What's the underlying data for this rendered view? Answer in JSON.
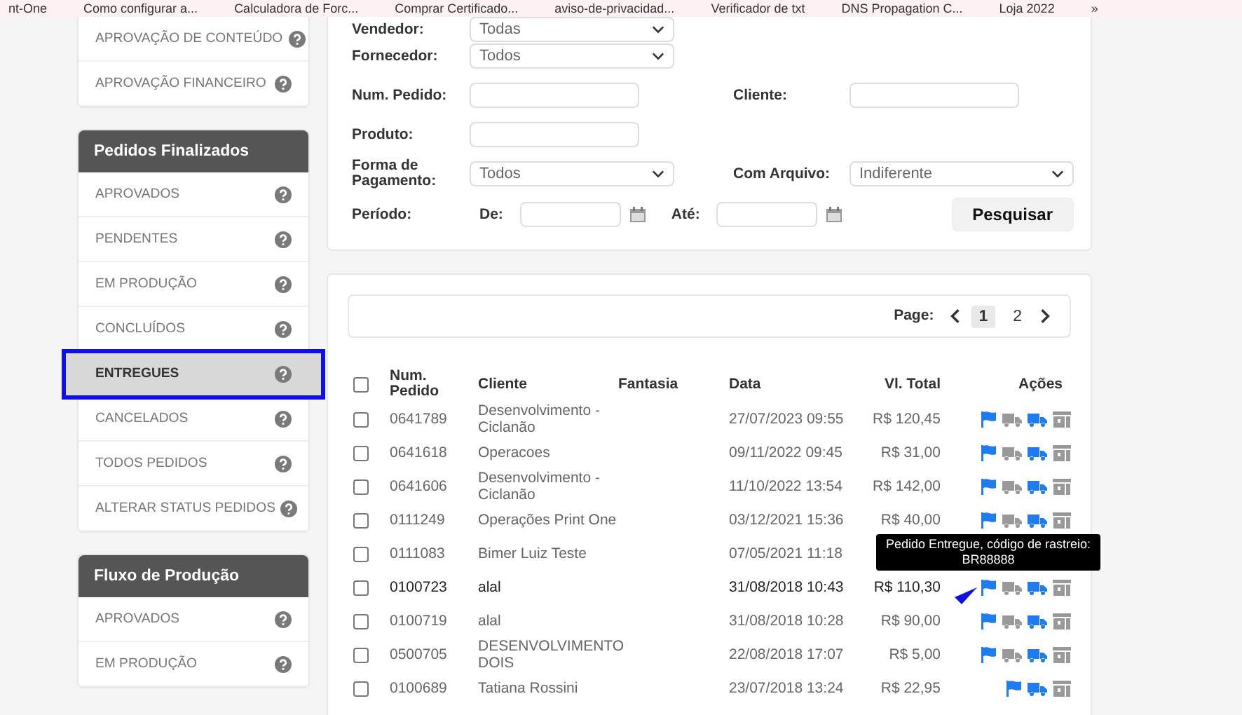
{
  "bookmarks": [
    "nt-One",
    "Como configurar a...",
    "Calculadora de Forc...",
    "Comprar Certificado...",
    "aviso-de-privacidad...",
    "Verificador de txt",
    "DNS Propagation C...",
    "Loja 2022",
    "»"
  ],
  "sidebar": {
    "sections": [
      {
        "items": [
          {
            "label": "APROVAÇÃO DE CONTEÚDO",
            "selected": false
          },
          {
            "label": "APROVAÇÃO FINANCEIRO",
            "selected": false
          }
        ]
      },
      {
        "title": "Pedidos Finalizados",
        "items": [
          {
            "label": "APROVADOS",
            "selected": false
          },
          {
            "label": "PENDENTES",
            "selected": false
          },
          {
            "label": "EM PRODUÇÃO",
            "selected": false
          },
          {
            "label": "CONCLUÍDOS",
            "selected": false
          },
          {
            "label": "ENTREGUES",
            "selected": true
          },
          {
            "label": "CANCELADOS",
            "selected": false
          },
          {
            "label": "TODOS PEDIDOS",
            "selected": false
          },
          {
            "label": "ALTERAR STATUS PEDIDOS",
            "selected": false
          }
        ]
      },
      {
        "title": "Fluxo de Produção",
        "items": [
          {
            "label": "APROVADOS",
            "selected": false
          },
          {
            "label": "EM PRODUÇÃO",
            "selected": false
          }
        ]
      }
    ]
  },
  "filters": {
    "rows": [
      {
        "fields": [
          {
            "label": "Vendedor:",
            "kind": "select",
            "value": "Todas"
          }
        ]
      },
      {
        "fields": [
          {
            "label": "Fornecedor:",
            "kind": "select",
            "value": "Todos"
          }
        ]
      },
      {
        "fields": [
          {
            "label": "Num. Pedido:",
            "kind": "text"
          },
          {
            "label": "Cliente:",
            "kind": "text"
          }
        ]
      },
      {
        "fields": [
          {
            "label": "Produto:",
            "kind": "text"
          }
        ]
      },
      {
        "fields": [
          {
            "label": "Forma de Pagamento:",
            "kind": "select",
            "value": "Todos"
          },
          {
            "label": "Com Arquivo:",
            "kind": "select",
            "value": "Indiferente"
          }
        ]
      }
    ],
    "period": {
      "label": "Período:",
      "from_label": "De:",
      "to_label": "Até:"
    },
    "search_button": "Pesquisar"
  },
  "pager": {
    "label": "Page:",
    "pages": [
      {
        "label": "1",
        "selected": true
      },
      {
        "label": "2",
        "selected": false
      }
    ]
  },
  "table": {
    "columns": [
      "Num. Pedido",
      "Cliente",
      "Fantasia",
      "Data",
      "Vl. Total",
      "Ações"
    ],
    "header_checked": false,
    "rows": [
      {
        "num": "0641789",
        "cliente": "Desenvolvimento - Ciclanão",
        "data": "27/07/2023 09:55",
        "total": "R$ 120,45",
        "checked": false,
        "highlighted": false,
        "actions": [
          {
            "kind": "flag"
          },
          {
            "kind": "truck",
            "active": false
          },
          {
            "kind": "truck",
            "active": true
          },
          {
            "kind": "archive"
          }
        ]
      },
      {
        "num": "0641618",
        "cliente": "Operacoes",
        "data": "09/11/2022 09:45",
        "total": "R$ 31,00",
        "checked": false,
        "highlighted": false,
        "actions": [
          {
            "kind": "flag"
          },
          {
            "kind": "truck",
            "active": false
          },
          {
            "kind": "truck",
            "active": true
          },
          {
            "kind": "archive"
          }
        ]
      },
      {
        "num": "0641606",
        "cliente": "Desenvolvimento - Ciclanão",
        "data": "11/10/2022 13:54",
        "total": "R$ 142,00",
        "checked": false,
        "highlighted": false,
        "actions": [
          {
            "kind": "flag"
          },
          {
            "kind": "truck",
            "active": false
          },
          {
            "kind": "truck",
            "active": true
          },
          {
            "kind": "archive"
          }
        ]
      },
      {
        "num": "0111249",
        "cliente": "Operações Print One",
        "data": "03/12/2021 15:36",
        "total": "R$ 40,00",
        "checked": false,
        "highlighted": false,
        "actions": [
          {
            "kind": "flag"
          },
          {
            "kind": "truck",
            "active": false
          },
          {
            "kind": "truck",
            "active": true
          },
          {
            "kind": "archive"
          }
        ]
      },
      {
        "num": "0111083",
        "cliente": "Bimer Luiz Teste",
        "data": "07/05/2021 11:18",
        "checked": false,
        "highlighted": false
      },
      {
        "num": "0100723",
        "cliente": "alal",
        "data": "31/08/2018 10:43",
        "total": "R$ 110,30",
        "checked": false,
        "highlighted": true,
        "tooltip": "Pedido Entregue, código de rastreio: BR88888",
        "actions": [
          {
            "kind": "flag"
          },
          {
            "kind": "truck",
            "active": false
          },
          {
            "kind": "truck",
            "active": true
          },
          {
            "kind": "archive"
          }
        ]
      },
      {
        "num": "0100719",
        "cliente": "alal",
        "data": "31/08/2018 10:28",
        "total": "R$ 90,00",
        "checked": false,
        "highlighted": false,
        "actions": [
          {
            "kind": "flag"
          },
          {
            "kind": "truck",
            "active": false
          },
          {
            "kind": "truck",
            "active": true
          },
          {
            "kind": "archive"
          }
        ]
      },
      {
        "num": "0500705",
        "cliente": "DESENVOLVIMENTO DOIS",
        "data": "22/08/2018 17:07",
        "total": "R$ 5,00",
        "checked": false,
        "highlighted": false,
        "actions": [
          {
            "kind": "flag"
          },
          {
            "kind": "truck",
            "active": false
          },
          {
            "kind": "truck",
            "active": true
          },
          {
            "kind": "archive"
          }
        ]
      },
      {
        "num": "0100689",
        "cliente": "Tatiana Rossini",
        "data": "23/07/2018 13:24",
        "total": "R$ 22,95",
        "checked": false,
        "highlighted": false,
        "actions": [
          {
            "kind": "flag"
          },
          {
            "kind": "truck",
            "active": true
          },
          {
            "kind": "archive"
          }
        ]
      }
    ]
  }
}
